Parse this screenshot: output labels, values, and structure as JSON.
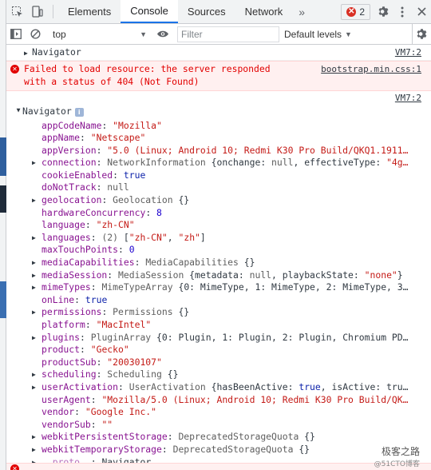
{
  "toolbar": {
    "tabs": [
      "Elements",
      "Console",
      "Sources",
      "Network"
    ],
    "more": "»",
    "error_count": "2"
  },
  "filterbar": {
    "context": "top",
    "filter_placeholder": "Filter",
    "levels": "Default levels"
  },
  "messages": {
    "m1": {
      "label": "Navigator",
      "source": "VM7:2"
    },
    "m2": {
      "text": "Failed to load resource: the server responded with a status of 404 (Not Found)",
      "source": "bootstrap.min.css:1"
    },
    "m3": {
      "label": "Navigator",
      "source": "VM7:2"
    }
  },
  "navigator_props": [
    {
      "key": "appCodeName",
      "value": "\"Mozilla\""
    },
    {
      "key": "appName",
      "value": "\"Netscape\""
    },
    {
      "key": "appVersion",
      "value": "\"5.0 (Linux; Android 10; Redmi K30 Pro Build/QKQ1.1911…"
    },
    {
      "key": "connection",
      "type": "NetworkInformation",
      "rest": " {onchange: null, effectiveType: \"4g…"
    },
    {
      "key": "cookieEnabled",
      "value": "true"
    },
    {
      "key": "doNotTrack",
      "value": "null"
    },
    {
      "key": "geolocation",
      "type": "Geolocation",
      "rest": " {}"
    },
    {
      "key": "hardwareConcurrency",
      "value": "8"
    },
    {
      "key": "language",
      "value": "\"zh-CN\""
    },
    {
      "key": "languages",
      "type": "(2)",
      "rest": " [\"zh-CN\", \"zh\"]"
    },
    {
      "key": "maxTouchPoints",
      "value": "0"
    },
    {
      "key": "mediaCapabilities",
      "type": "MediaCapabilities",
      "rest": " {}"
    },
    {
      "key": "mediaSession",
      "type": "MediaSession",
      "rest": " {metadata: null, playbackState: \"none\"}"
    },
    {
      "key": "mimeTypes",
      "type": "MimeTypeArray",
      "rest": " {0: MimeType, 1: MimeType, 2: MimeType, 3…"
    },
    {
      "key": "onLine",
      "value": "true"
    },
    {
      "key": "permissions",
      "type": "Permissions",
      "rest": " {}"
    },
    {
      "key": "platform",
      "value": "\"MacIntel\""
    },
    {
      "key": "plugins",
      "type": "PluginArray",
      "rest": " {0: Plugin, 1: Plugin, 2: Plugin, Chromium PD…"
    },
    {
      "key": "product",
      "value": "\"Gecko\""
    },
    {
      "key": "productSub",
      "value": "\"20030107\""
    },
    {
      "key": "scheduling",
      "type": "Scheduling",
      "rest": " {}"
    },
    {
      "key": "userActivation",
      "type": "UserActivation",
      "rest": " {hasBeenActive: true, isActive: tru…"
    },
    {
      "key": "userAgent",
      "value": "\"Mozilla/5.0 (Linux; Android 10; Redmi K30 Pro Build/QK…"
    },
    {
      "key": "vendor",
      "value": "\"Google Inc.\""
    },
    {
      "key": "vendorSub",
      "value": "\"\""
    },
    {
      "key": "webkitPersistentStorage",
      "type": "DeprecatedStorageQuota",
      "rest": " {}"
    },
    {
      "key": "webkitTemporaryStorage",
      "type": "DeprecatedStorageQuota",
      "rest": " {}"
    },
    {
      "key": "__proto__",
      "value": "Navigator"
    }
  ],
  "watermark": {
    "main": "极客之路",
    "sub": "@51CTO博客"
  },
  "colors": {
    "accent": "#1a73e8",
    "error": "#e20000",
    "error_bg": "#fff0f0",
    "key": "#881391",
    "string": "#c41a16",
    "number": "#1c00cf"
  }
}
